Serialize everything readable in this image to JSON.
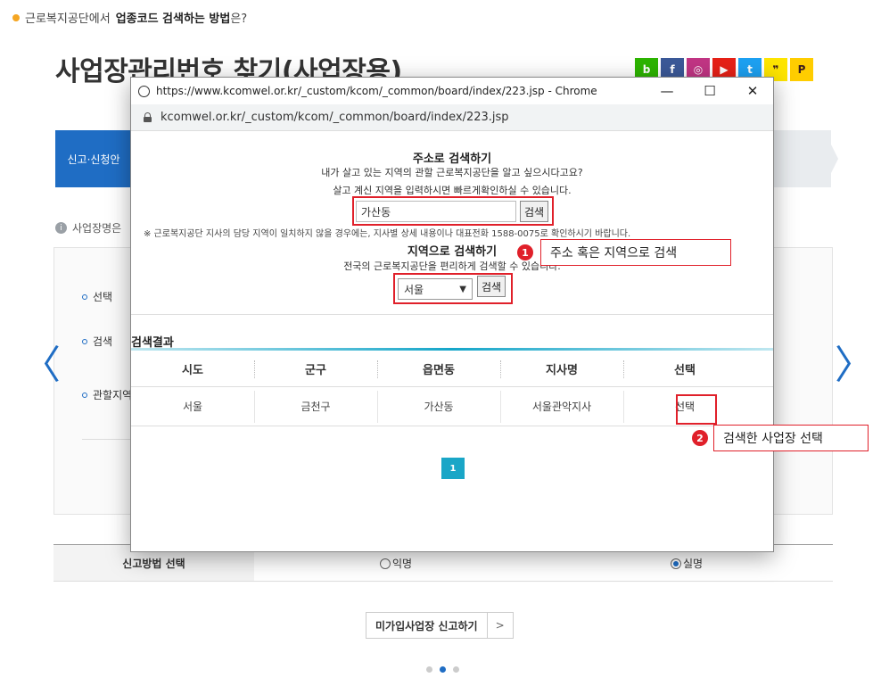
{
  "page": {
    "question_prefix": "근로복지공단에서",
    "question_bold": "업종코드 검색하는 방법",
    "question_suffix": "은?",
    "title": "사업장관리번호 찾기(사업장용)",
    "step_active": "신고·신청안",
    "note": "사업장명은",
    "form_rows": [
      "선택",
      "검색",
      "관할지역"
    ],
    "report_method_label": "신고방법 선택",
    "report_options": [
      "익명",
      "실명"
    ],
    "report_selected": "실명",
    "cta_label": "미가입사업장 신고하기",
    "cta_arrow": ">",
    "nav_prev": "〈",
    "nav_next": "〉"
  },
  "social": [
    {
      "icon": "blog-icon",
      "glyph": "b",
      "color": "#2db400"
    },
    {
      "icon": "facebook-icon",
      "glyph": "f",
      "color": "#3b5998"
    },
    {
      "icon": "instagram-icon",
      "glyph": "◎",
      "color": "#c13584"
    },
    {
      "icon": "youtube-icon",
      "glyph": "▶",
      "color": "#e62117"
    },
    {
      "icon": "twitter-icon",
      "glyph": "t",
      "color": "#1da1f2"
    },
    {
      "icon": "kakao-icon",
      "glyph": "❞",
      "color": "#fee500"
    },
    {
      "icon": "kakaostory-icon",
      "glyph": "P",
      "color": "#ffcd00"
    }
  ],
  "popup": {
    "window_title": "https://www.kcomwel.or.kr/_custom/kcom/_common/board/index/223.jsp - Chrome",
    "address": "kcomwel.or.kr/_custom/kcom/_common/board/index/223.jsp",
    "minimize": "—",
    "maximize": "☐",
    "close": "✕",
    "address_search": {
      "title": "주소로 검색하기",
      "desc1": "내가 살고 있는 지역의 관할 근로복지공단을 알고 싶으시다고요?",
      "desc2": "살고 계신 지역을 입력하시면 빠르게확인하실 수 있습니다.",
      "input_value": "가산동",
      "button": "검색"
    },
    "warning": "※ 근로복지공단 지사의 담당 지역이 일치하지 않을 경우에는, 지사별 상세 내용이나 대표전화 1588-0075로 확인하시기 바랍니다.",
    "region_search": {
      "title": "지역으로 검색하기",
      "desc": "전국의 근로복지공단을 편리하게 검색할 수 있습니다.",
      "selected": "서울",
      "button": "검색"
    },
    "results": {
      "title": "검색결과",
      "columns": [
        "시도",
        "군구",
        "읍면동",
        "지사명",
        "선택"
      ],
      "rows": [
        [
          "서울",
          "금천구",
          "가산동",
          "서울관악지사",
          "선택"
        ]
      ]
    },
    "page_number": "1"
  },
  "callouts": [
    {
      "number": "1",
      "text": "주소 혹은 지역으로 검색"
    },
    {
      "number": "2",
      "text": "검색한 사업장 선택"
    }
  ],
  "colors": {
    "brand_blue": "#1f6dc4",
    "accent_red": "#e0202a",
    "teal": "#1aa6c7"
  }
}
